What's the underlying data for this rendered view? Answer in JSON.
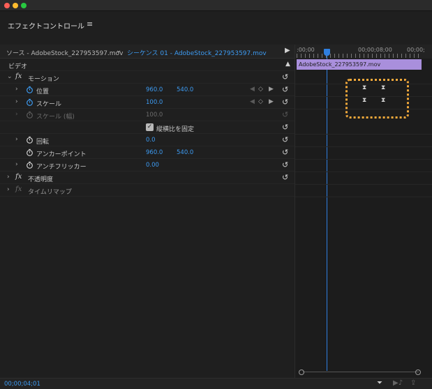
{
  "window": {
    "title": ""
  },
  "panel": {
    "title": "エフェクトコントロール",
    "menu_icon": "≡"
  },
  "source_bar": {
    "source_label": "ソース - AdobeStock_227953597.mov",
    "sequence_label": "シーケンス 01 - AdobeStock_227953597.mov"
  },
  "timeline": {
    "ruler_start": ":00;00",
    "ruler_mid": "00;00;08;00",
    "ruler_end": "00;00;",
    "clip_name": "AdobeStock_227953597.mov"
  },
  "params": {
    "section_video": "ビデオ",
    "motion": {
      "label": "モーション"
    },
    "position": {
      "label": "位置",
      "x": "960.0",
      "y": "540.0"
    },
    "scale": {
      "label": "スケール",
      "value": "100.0"
    },
    "scale_width": {
      "label": "スケール (幅)",
      "value": "100.0"
    },
    "uniform_scale": {
      "label": "縦横比を固定",
      "checked": true
    },
    "rotation": {
      "label": "回転",
      "value": "0.0"
    },
    "anchor": {
      "label": "アンカーポイント",
      "x": "960.0",
      "y": "540.0"
    },
    "antiflicker": {
      "label": "アンチフリッカー",
      "value": "0.00"
    },
    "opacity": {
      "label": "不透明度"
    },
    "time_remap": {
      "label": "タイムリマップ"
    }
  },
  "status": {
    "timecode": "00;00;04;01"
  },
  "colors": {
    "accent_blue": "#3d9bf2",
    "clip_purple": "#a98fdc",
    "highlight_orange": "#f2a93b"
  }
}
